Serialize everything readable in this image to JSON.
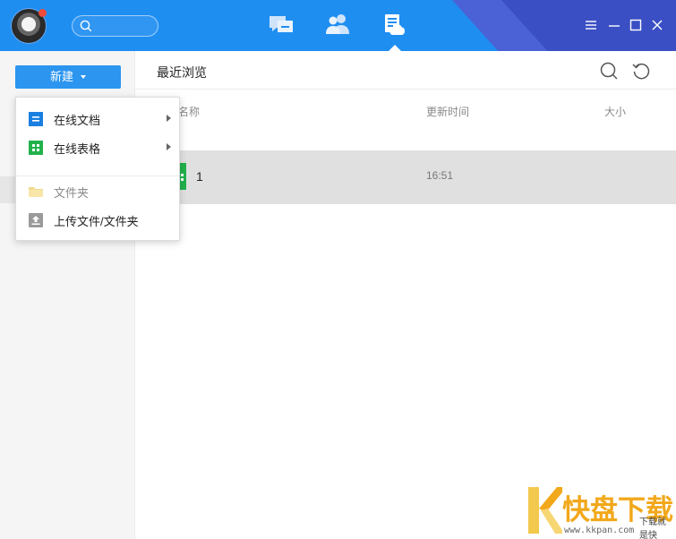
{
  "titlebar": {
    "search_placeholder": "",
    "tabs": [
      {
        "name": "messages-tab",
        "icon": "chat-icon"
      },
      {
        "name": "contacts-tab",
        "icon": "contacts-icon"
      },
      {
        "name": "files-tab",
        "icon": "cloud-doc-icon",
        "active": true
      }
    ],
    "window_controls": [
      "menu-icon",
      "minimize-icon",
      "maximize-icon",
      "close-icon"
    ]
  },
  "sidebar": {
    "new_button_label": "新建"
  },
  "new_menu": {
    "items": [
      {
        "label": "在线文档",
        "icon": "online-doc-icon",
        "submenu": true
      },
      {
        "label": "在线表格",
        "icon": "online-sheet-icon",
        "submenu": true
      },
      {
        "label": "文件夹",
        "icon": "folder-icon",
        "disabled": true
      },
      {
        "label": "上传文件/文件夹",
        "icon": "upload-icon"
      }
    ]
  },
  "main": {
    "title": "最近浏览",
    "columns": {
      "name": "名称",
      "updated": "更新时间",
      "size": "大小"
    },
    "rows": [
      {
        "name": "1",
        "updated": "16:51",
        "size": ""
      }
    ]
  },
  "watermark": {
    "title": "快盘下载",
    "subtitle": "下载就是快",
    "url": "www.kkpan.com"
  },
  "colors": {
    "titlebar": "#1f8ef1",
    "accent": "#2b95f0",
    "sheet_green": "#22b24c",
    "doc_blue": "#1a7fe0",
    "watermark_orange": "#f2a81b"
  }
}
